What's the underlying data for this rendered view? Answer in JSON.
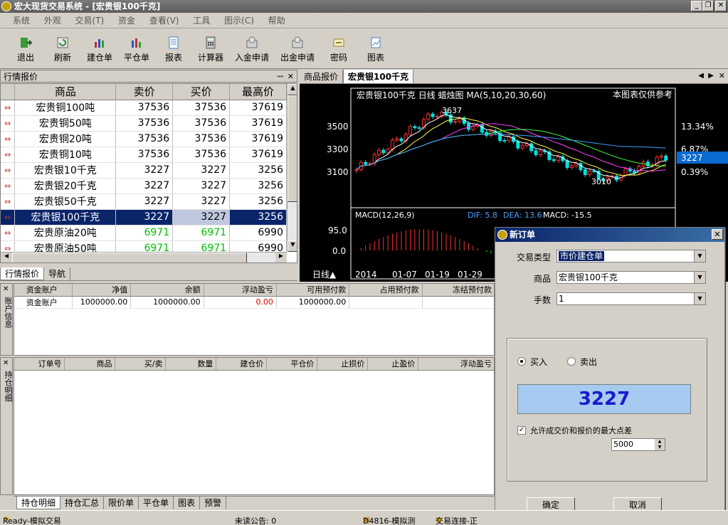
{
  "window": {
    "title": "宏大现货交易系统 - [宏贵银100千克]"
  },
  "menu": [
    "系统",
    "外观",
    "交易(T)",
    "资金",
    "查看(V)",
    "工具",
    "图示(C)",
    "帮助"
  ],
  "toolbar": [
    {
      "label": "退出",
      "icon": "exit-icon",
      "color": "#2a8a2a"
    },
    {
      "label": "刷新",
      "icon": "refresh-icon",
      "color": "#2a8a2a"
    },
    {
      "label": "建仓单",
      "icon": "open-position-icon",
      "color": "#c03030"
    },
    {
      "label": "平仓单",
      "icon": "close-position-icon",
      "color": "#3050c0"
    },
    {
      "label": "报表",
      "icon": "report-icon",
      "color": "#4080c0"
    },
    {
      "label": "计算器",
      "icon": "calculator-icon",
      "color": "#808080"
    },
    {
      "label": "入金申请",
      "icon": "deposit-icon",
      "color": "#a0a0a0"
    },
    {
      "label": "出金申请",
      "icon": "withdraw-icon",
      "color": "#a0a0a0"
    },
    {
      "label": "密码",
      "icon": "password-icon",
      "color": "#c0a040"
    },
    {
      "label": "图表",
      "icon": "chart-icon",
      "color": "#4080c0"
    }
  ],
  "quotes_panel": {
    "title": "行情报价",
    "columns": [
      "商品",
      "卖价",
      "买价",
      "最高价"
    ],
    "rows": [
      {
        "name": "宏贵铜100吨",
        "sell": "37536",
        "buy": "37536",
        "high": "37619"
      },
      {
        "name": "宏贵铜50吨",
        "sell": "37536",
        "buy": "37536",
        "high": "37619"
      },
      {
        "name": "宏贵铜20吨",
        "sell": "37536",
        "buy": "37536",
        "high": "37619"
      },
      {
        "name": "宏贵铜10吨",
        "sell": "37536",
        "buy": "37536",
        "high": "37619"
      },
      {
        "name": "宏贵银10千克",
        "sell": "3227",
        "buy": "3227",
        "high": "3256"
      },
      {
        "name": "宏贵银20千克",
        "sell": "3227",
        "buy": "3227",
        "high": "3256"
      },
      {
        "name": "宏贵银50千克",
        "sell": "3227",
        "buy": "3227",
        "high": "3256"
      },
      {
        "name": "宏贵银100千克",
        "sell": "3227",
        "buy": "3227",
        "high": "3256"
      },
      {
        "name": "宏贵原油20吨",
        "sell": "6971",
        "buy": "6971",
        "high": "6990"
      },
      {
        "name": "宏贵原油50吨",
        "sell": "6971",
        "buy": "6971",
        "high": "6990"
      }
    ],
    "tabs": [
      "行情报价",
      "导航"
    ]
  },
  "chart_tabs": [
    "商品报价",
    "宏贵银100千克"
  ],
  "chart": {
    "header": "宏贵银100千克 日线  蜡烛图 MA(5,10,20,30,60)",
    "note": "本图表仅供参考",
    "y_ticks": [
      "3500",
      "3300",
      "3100"
    ],
    "right_labels": [
      "13.34%",
      "6.87%",
      "3227",
      "0.39%"
    ],
    "high_label": "3637",
    "low_label": "3010",
    "macd_label": "MACD(12,26,9)",
    "macd_dif": "DIF: 5.8",
    "macd_dea": "DEA: 13.6",
    "macd_val": "MACD: -15.5",
    "macd_ticks": [
      "95.0",
      "0.0"
    ],
    "period": "日线▲",
    "x_ticks": [
      "2014",
      "01-07",
      "01-19",
      "01-29"
    ]
  },
  "account": {
    "side_label": "账户信息",
    "columns": [
      "资金账户",
      "净值",
      "余额",
      "浮动盈亏",
      "可用预付款",
      "占用预付款",
      "冻结预付款"
    ],
    "row": [
      "资金账户",
      "1000000.00",
      "1000000.00",
      "0.00",
      "1000000.00",
      "",
      ""
    ]
  },
  "positions": {
    "side_label": "持仓明细",
    "columns": [
      "订单号",
      "商品",
      "买/卖",
      "数量",
      "建仓价",
      "平仓价",
      "止损价",
      "止盈价",
      "浮动盈亏"
    ],
    "tabs": [
      "持仓明细",
      "持仓汇总",
      "限价单",
      "平仓单",
      "图表",
      "预警"
    ]
  },
  "dialog": {
    "title": "新订单",
    "trade_type_label": "交易类型",
    "trade_type_value": "市价建仓单",
    "product_label": "商品",
    "product_value": "宏贵银100千克",
    "lots_label": "手数",
    "lots_value": "1",
    "buy_label": "买入",
    "sell_label": "卖出",
    "price": "3227",
    "allow_label": "允许成交价和报价的最大点差",
    "spread_value": "5000",
    "ok_label": "确定",
    "cancel_label": "取消"
  },
  "status": {
    "ready": "Ready-模拟交易",
    "notice": "未读公告: 0",
    "account": "D4816-模拟测",
    "connection": "交易连接-正"
  }
}
